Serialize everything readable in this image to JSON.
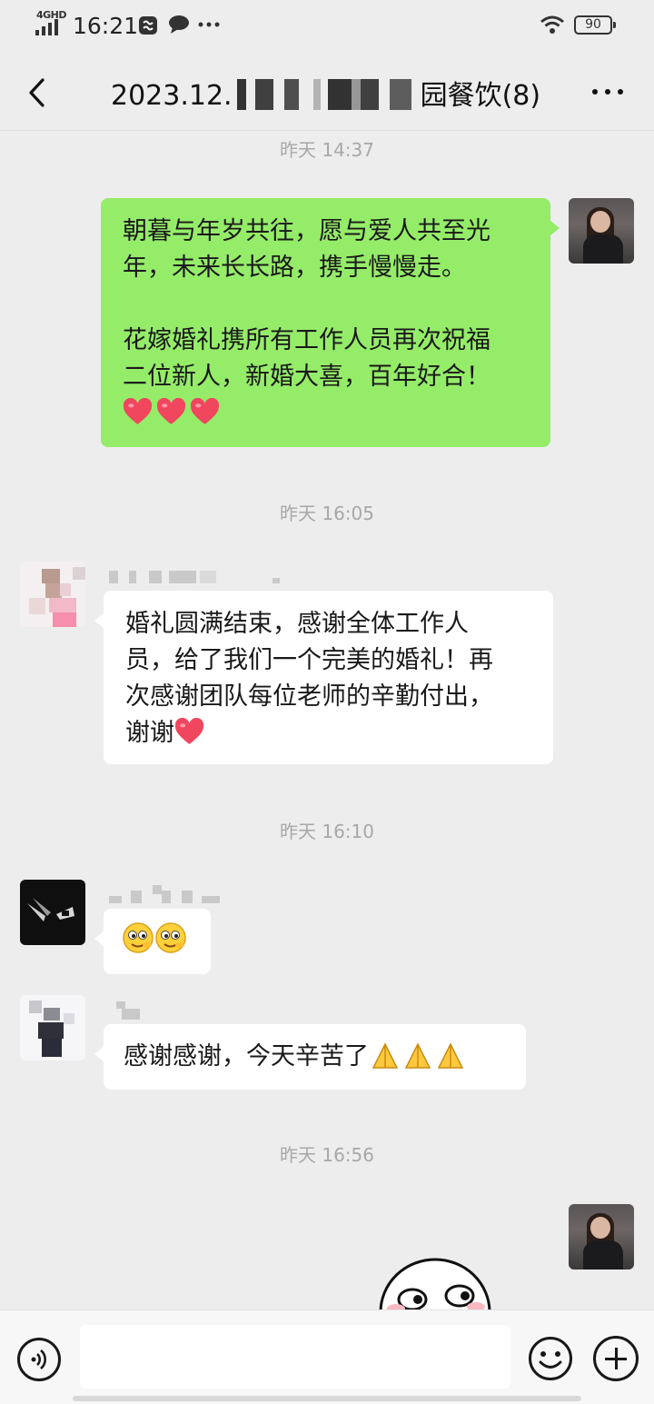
{
  "status_bar": {
    "network": "4GHD",
    "time": "16:21",
    "battery": "90"
  },
  "header": {
    "title_prefix": "2023.12.",
    "title_suffix": "园餐饮(8)"
  },
  "messages": [
    {
      "timestamp": "昨天 14:37"
    },
    {
      "sender": "self",
      "lines": [
        "朝暮与年岁共往，愿与爱人共至光",
        "年，未来长长路，携手慢慢走。",
        "",
        "花嫁婚礼携所有工作人员再次祝福",
        "二位新人，新婚大喜，百年好合！"
      ]
    },
    {
      "timestamp": "昨天 16:05"
    },
    {
      "sender": "other",
      "lines": [
        "婚礼圆满结束，感谢全体工作人",
        "员，给了我们一个完美的婚礼！再",
        "次感谢团队每位老师的辛勤付出，",
        "谢谢"
      ]
    },
    {
      "timestamp": "昨天 16:10"
    },
    {
      "sender": "other",
      "text": "感谢感谢，今天辛苦了"
    },
    {
      "timestamp": "昨天 16:56"
    }
  ],
  "colors": {
    "self_bubble": "#95ec69",
    "other_bubble": "#ffffff",
    "background": "#ededed",
    "timestamp": "#a8a8a8"
  },
  "icons": [
    "back-arrow-icon",
    "more-icon",
    "voice-icon",
    "emoji-icon",
    "plus-icon",
    "heart-emoji",
    "grin-emoji",
    "pray-emoji",
    "wifi-icon",
    "signal-icon"
  ]
}
